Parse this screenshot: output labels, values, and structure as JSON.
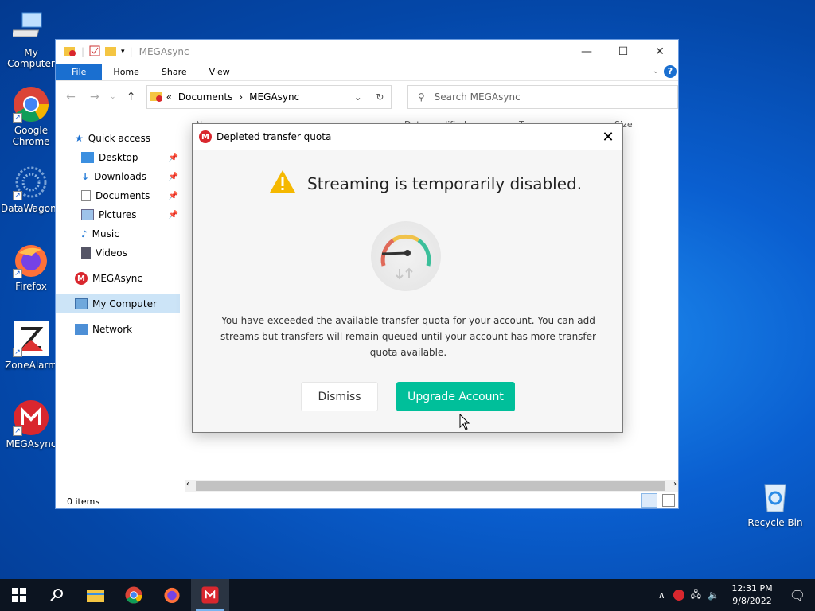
{
  "desktop": {
    "icons": [
      {
        "label": "My Computer"
      },
      {
        "label": "Google Chrome"
      },
      {
        "label": "DataWagon..."
      },
      {
        "label": "Firefox"
      },
      {
        "label": "ZoneAlarm"
      },
      {
        "label": "MEGAsync"
      },
      {
        "label": "Recycle Bin"
      }
    ]
  },
  "explorer": {
    "title": "MEGAsync",
    "ribbon_tabs": [
      "File",
      "Home",
      "Share",
      "View"
    ],
    "address": {
      "prefix": "«",
      "parts": [
        "Documents",
        "MEGAsync"
      ],
      "separator": "›"
    },
    "search_placeholder": "Search MEGAsync",
    "column_headers": {
      "name": "N",
      "date_modified": "Date modified",
      "type": "Type",
      "size": "Size"
    },
    "nav": {
      "quick_access": "Quick access",
      "desktop": "Desktop",
      "downloads": "Downloads",
      "documents": "Documents",
      "pictures": "Pictures",
      "music": "Music",
      "videos": "Videos",
      "megasync": "MEGAsync",
      "my_computer": "My Computer",
      "network": "Network"
    },
    "status": "0 items"
  },
  "dialog": {
    "title": "Depleted transfer quota",
    "headline": "Streaming is temporarily disabled.",
    "message": "You have exceeded the available transfer quota for your account. You can add streams but transfers will remain queued until your account has more transfer quota available.",
    "dismiss_label": "Dismiss",
    "upgrade_label": "Upgrade Account",
    "colors": {
      "upgrade": "#00bf9a",
      "mega_red": "#d9272e",
      "warning": "#f5b800"
    }
  },
  "taskbar": {
    "time": "12:31 PM",
    "date": "9/8/2022"
  }
}
